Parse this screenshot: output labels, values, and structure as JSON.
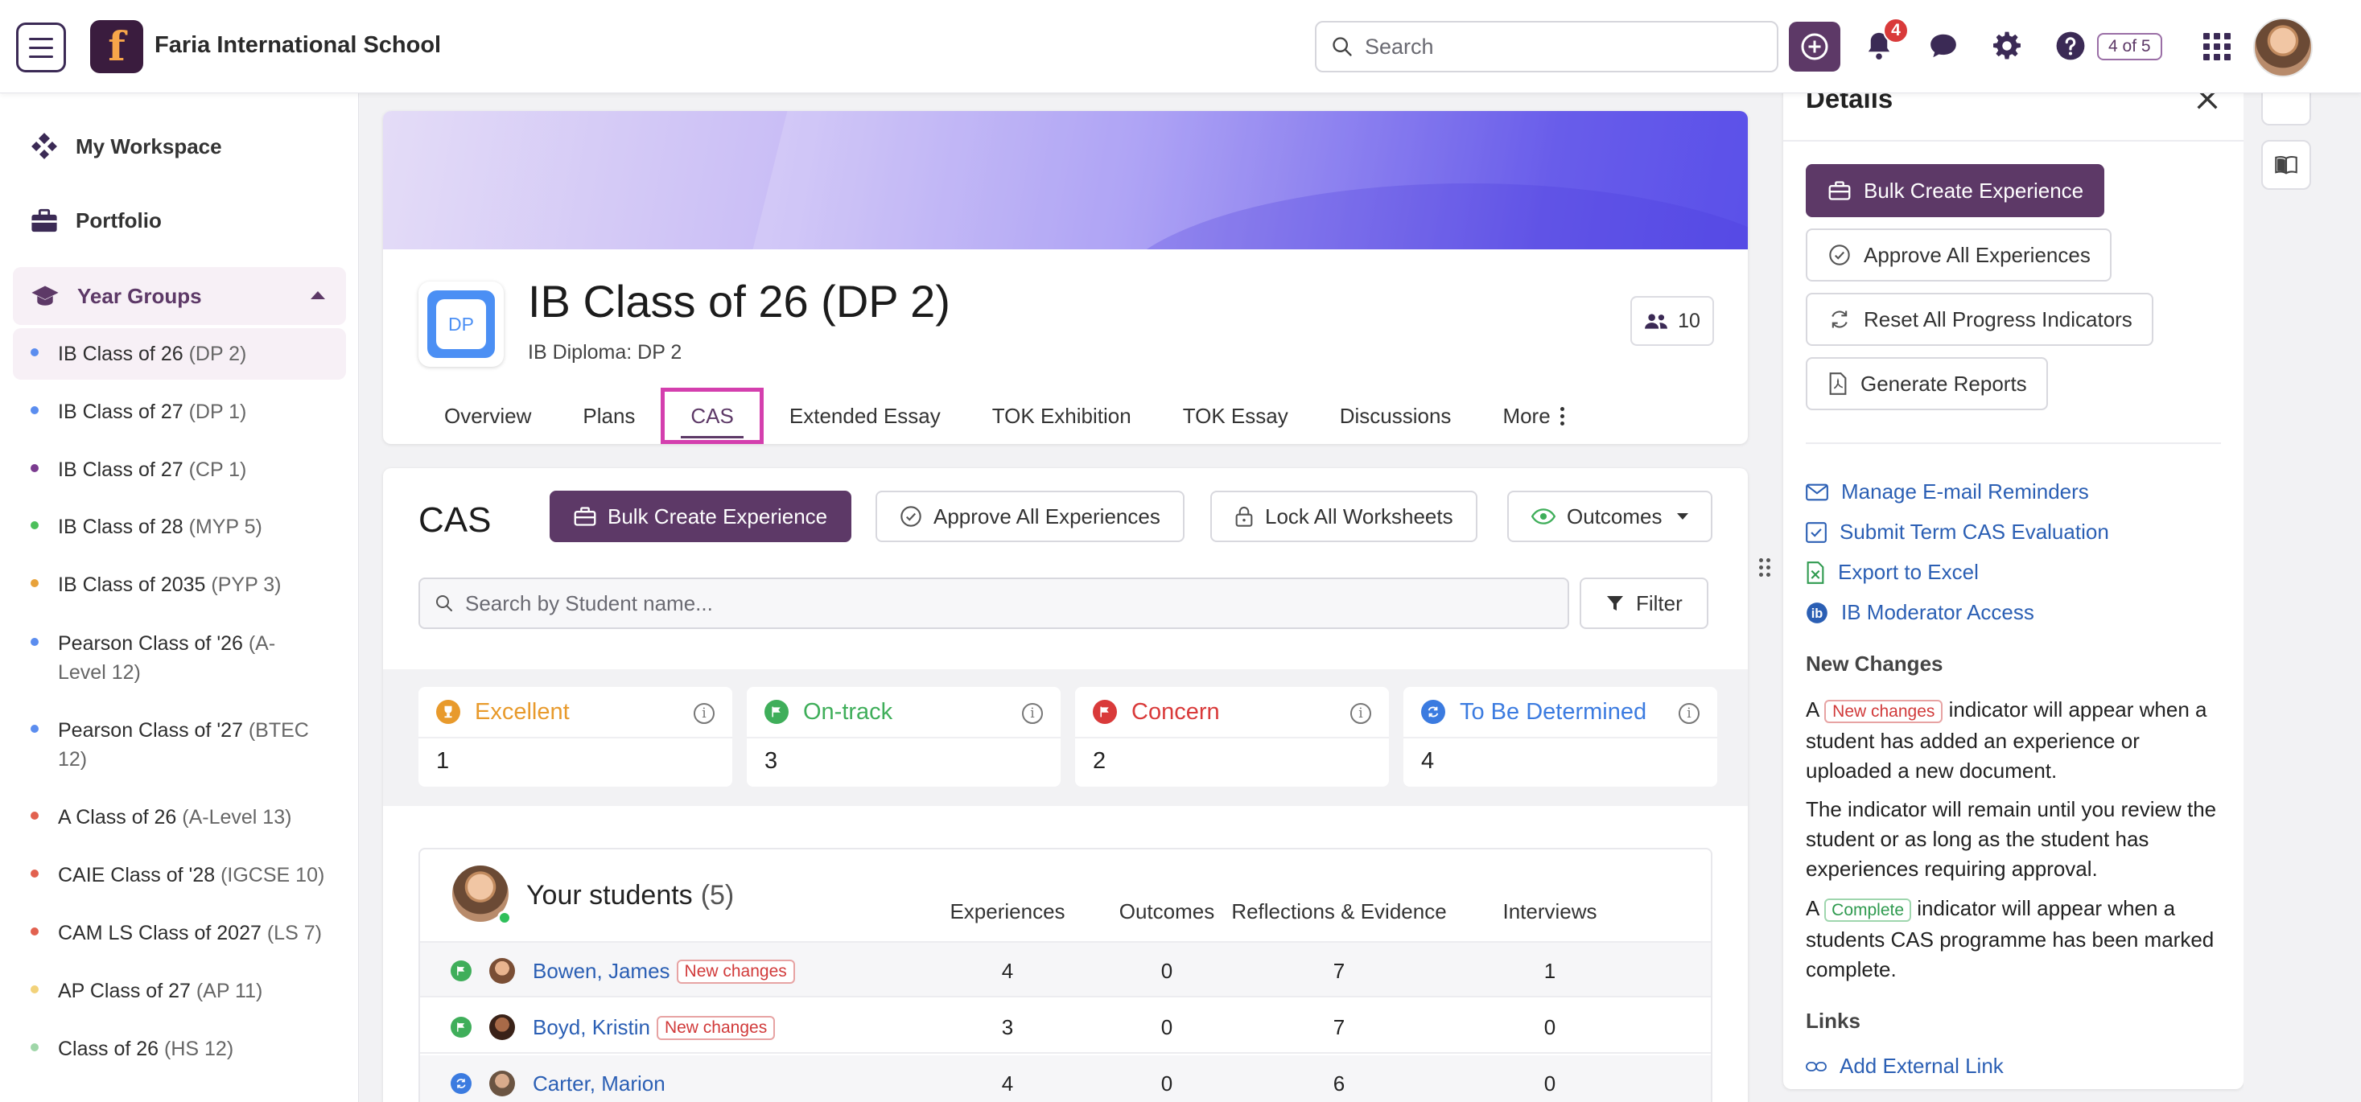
{
  "header": {
    "school_name": "Faria International School",
    "search_placeholder": "Search",
    "notifications_count": "4",
    "page_counter": "4 of 5",
    "brand_color": "#5d3967"
  },
  "sidebar": {
    "nav": [
      {
        "label": "My Workspace",
        "icon": "workspace-icon"
      },
      {
        "label": "Portfolio",
        "icon": "briefcase-icon"
      },
      {
        "label": "Year Groups",
        "icon": "graduation-cap-icon"
      }
    ],
    "classes": [
      {
        "name": "IB Class of 26",
        "tag": "(DP 2)",
        "color": "#5b8def",
        "active": true
      },
      {
        "name": "IB Class of 27",
        "tag": "(DP 1)",
        "color": "#5b8def"
      },
      {
        "name": "IB Class of 27",
        "tag": "(CP 1)",
        "color": "#7a3b8f"
      },
      {
        "name": "IB Class of 28",
        "tag": "(MYP 5)",
        "color": "#4cbf5b"
      },
      {
        "name": "IB Class of 2035",
        "tag": "(PYP 3)",
        "color": "#e8a23a"
      },
      {
        "name": "Pearson Class of '26",
        "tag": "(A-Level 12)",
        "color": "#5b8def"
      },
      {
        "name": "Pearson Class of '27",
        "tag": "(BTEC 12)",
        "color": "#5b8def"
      },
      {
        "name": "A Class of 26",
        "tag": "(A-Level 13)",
        "color": "#e2614f"
      },
      {
        "name": "CAIE Class of '28",
        "tag": "(IGCSE 10)",
        "color": "#e2614f"
      },
      {
        "name": "CAM LS Class of 2027",
        "tag": "(LS 7)",
        "color": "#e2614f"
      },
      {
        "name": "AP Class of 27",
        "tag": "(AP 11)",
        "color": "#f2d27a"
      },
      {
        "name": "Class of 26",
        "tag": "(HS 12)",
        "color": "#9fd6a8"
      }
    ]
  },
  "class_header": {
    "icon_text": "DP",
    "title": "IB Class of 26 (DP 2)",
    "subtitle": "IB Diploma: DP 2",
    "members_count": "10",
    "tabs": [
      "Overview",
      "Plans",
      "CAS",
      "Extended Essay",
      "TOK Exhibition",
      "TOK Essay",
      "Discussions",
      "More"
    ],
    "active_tab": "CAS"
  },
  "cas": {
    "title": "CAS",
    "bulk_create_label": "Bulk Create Experience",
    "approve_all_label": "Approve All Experiences",
    "lock_all_label": "Lock All Worksheets",
    "outcomes_label": "Outcomes",
    "search_placeholder": "Search by Student name...",
    "filter_label": "Filter",
    "stats": [
      {
        "label": "Excellent",
        "value": "1",
        "color": "#e89a2c"
      },
      {
        "label": "On-track",
        "value": "3",
        "color": "#3fae5a"
      },
      {
        "label": "Concern",
        "value": "2",
        "color": "#d93a3a"
      },
      {
        "label": "To Be Determined",
        "value": "4",
        "color": "#3b7be0"
      }
    ],
    "students_title": "Your students",
    "students_count": "(5)",
    "columns": [
      "Experiences",
      "Outcomes",
      "Reflections & Evidence",
      "Interviews"
    ],
    "students": [
      {
        "name": "Bowen, James",
        "status": "on-track",
        "new_changes": "New changes",
        "experiences": "4",
        "outcomes": "0",
        "reflections": "7",
        "interviews": "1"
      },
      {
        "name": "Boyd, Kristin",
        "status": "on-track",
        "new_changes": "New changes",
        "experiences": "3",
        "outcomes": "0",
        "reflections": "7",
        "interviews": "0"
      },
      {
        "name": "Carter, Marion",
        "status": "tbd",
        "new_changes": "",
        "experiences": "4",
        "outcomes": "0",
        "reflections": "6",
        "interviews": "0"
      }
    ]
  },
  "details": {
    "title": "Details",
    "buttons": [
      "Bulk Create Experience",
      "Approve All Experiences",
      "Reset All Progress Indicators",
      "Generate Reports"
    ],
    "links": [
      {
        "label": "Manage E-mail Reminders",
        "icon": "envelope-icon"
      },
      {
        "label": "Submit Term CAS Evaluation",
        "icon": "checkbox-icon"
      },
      {
        "label": "Export to Excel",
        "icon": "excel-icon"
      },
      {
        "label": "IB Moderator Access",
        "icon": "ib-icon"
      }
    ],
    "new_changes_heading": "New Changes",
    "p1_before": "A",
    "p1_pill": "New changes",
    "p1_after": "indicator will appear when a student has added an experience or uploaded a new document.",
    "p2": "The indicator will remain until you review the student or as long as the student has experiences requiring approval.",
    "p3_before": "A",
    "p3_pill": "Complete",
    "p3_after": "indicator will appear when a students CAS programme has been marked complete.",
    "links_heading": "Links",
    "add_link_label": "Add External Link"
  }
}
